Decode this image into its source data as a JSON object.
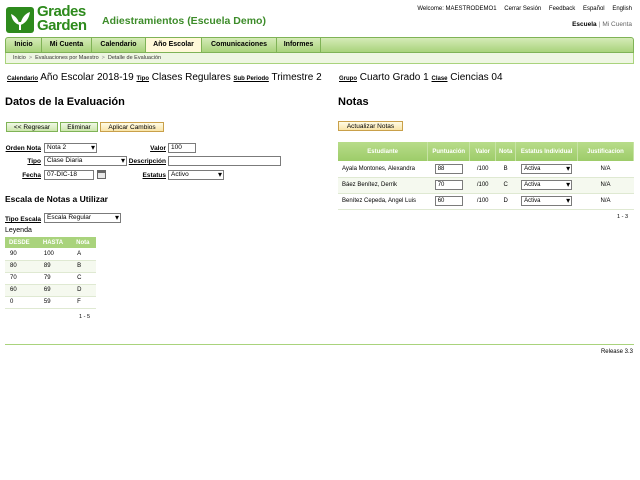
{
  "logo": {
    "line1": "Grades",
    "line2": "Garden"
  },
  "app_title": "Adiestramientos (Escuela Demo)",
  "top_links": {
    "welcome": "Welcome: MAESTRODEMO1",
    "logout": "Cerrar Sesión",
    "feedback": "Feedback",
    "spanish": "Español",
    "english": "English"
  },
  "scope": {
    "school": "Escuela",
    "separator": "|",
    "account": "Mi Cuenta"
  },
  "nav": [
    "Inicio",
    "Mi Cuenta",
    "Calendario",
    "Año Escolar",
    "Comunicaciones",
    "Informes"
  ],
  "breadcrumb": [
    "Inicio",
    "Evaluaciones por Maestro",
    "Detalle de Evaluación"
  ],
  "breadcrumb_arrow": ">",
  "context": {
    "calendar_label": "Calendario",
    "calendar_value": "Año Escolar 2018-19",
    "type_label": "Tipo",
    "type_value": "Clases Regulares",
    "subperiod_label": "Sub Periodo",
    "subperiod_value": "Trimestre 2",
    "group_label": "Grupo",
    "group_value": "Cuarto Grado 1",
    "class_label": "Clase",
    "class_value": "Ciencias 04"
  },
  "left": {
    "heading": "Datos de la Evaluación",
    "buttons": {
      "back": "<< Regresar",
      "delete": "Eliminar",
      "apply": "Aplicar Cambios"
    },
    "form": {
      "orden_label": "Orden Nota",
      "orden_value": "Nota 2",
      "valor_label": "Valor",
      "valor_value": "100",
      "tipo_label": "Tipo",
      "tipo_value": "Clase Diaria",
      "descripcion_label": "Descripción",
      "descripcion_value": "",
      "fecha_label": "Fecha",
      "fecha_value": "07-DIC-18",
      "estatus_label": "Estatus",
      "estatus_value": "Activo"
    },
    "scale_heading": "Escala de Notas a Utilizar",
    "scale_type_label": "Tipo Escala",
    "scale_type_value": "Escala Regular",
    "legend_label": "Leyenda",
    "grade_headers": [
      "DESDE",
      "HASTA",
      "Nota"
    ],
    "grade_rows": [
      [
        "90",
        "100",
        "A"
      ],
      [
        "80",
        "89",
        "B"
      ],
      [
        "70",
        "79",
        "C"
      ],
      [
        "60",
        "69",
        "D"
      ],
      [
        "0",
        "59",
        "F"
      ]
    ],
    "grade_pager": "1 - 5"
  },
  "right": {
    "heading": "Notas",
    "update_button": "Actualizar Notas",
    "headers": [
      "Estudiante",
      "Puntuación",
      "Valor",
      "Nota",
      "Estatus Individual",
      "Justificacion"
    ],
    "rows": [
      {
        "student": "Ayala Montones, Alexandra",
        "score": "88",
        "value": "/100",
        "grade": "B",
        "status": "Activa",
        "justification": "N/A"
      },
      {
        "student": "Báez Benítez, Derrik",
        "score": "70",
        "value": "/100",
        "grade": "C",
        "status": "Activa",
        "justification": "N/A"
      },
      {
        "student": "Benítez Cepeda, Angel Luis",
        "score": "60",
        "value": "/100",
        "grade": "D",
        "status": "Activa",
        "justification": "N/A"
      }
    ],
    "pager": "1 - 3"
  },
  "release": "Release 3.3",
  "colors": {
    "brand_green": "#2d8a1c",
    "nav_green": "#a9d37c",
    "title_green": "#3d8c2a"
  }
}
